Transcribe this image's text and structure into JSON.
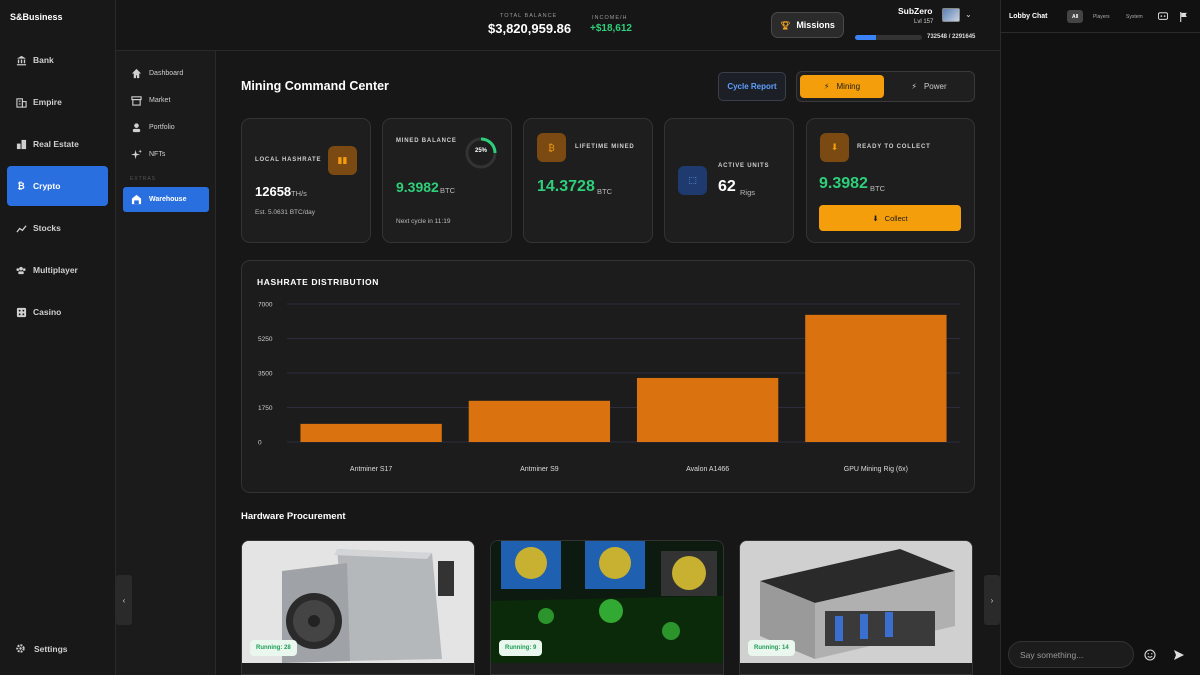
{
  "app": {
    "brand": "S&Business"
  },
  "sidebar": {
    "items": [
      {
        "label": "Bank",
        "icon": "bank-icon"
      },
      {
        "label": "Empire",
        "icon": "building-icon"
      },
      {
        "label": "Real Estate",
        "icon": "city-icon"
      },
      {
        "label": "Crypto",
        "icon": "bitcoin-icon",
        "active": true
      },
      {
        "label": "Stocks",
        "icon": "trend-icon"
      },
      {
        "label": "Multiplayer",
        "icon": "users-icon"
      },
      {
        "label": "Casino",
        "icon": "dice-icon"
      }
    ],
    "settings_label": "Settings"
  },
  "subnav": {
    "items": [
      {
        "label": "Dashboard",
        "icon": "home-icon"
      },
      {
        "label": "Market",
        "icon": "store-icon"
      },
      {
        "label": "Portfolio",
        "icon": "user-icon"
      },
      {
        "label": "NFTs",
        "icon": "sparkle-icon"
      }
    ],
    "section_label": "EXTRAS",
    "extras": [
      {
        "label": "Warehouse",
        "icon": "warehouse-icon",
        "active": true
      }
    ]
  },
  "topbar": {
    "balance_label": "TOTAL BALANCE",
    "balance_value": "$3,820,959.86",
    "income_label": "INCOME/H",
    "income_value": "+$18,612",
    "missions_label": "Missions",
    "user_name": "SubZero",
    "user_level": "Lvl 157",
    "xp_text": "732548 / 2291645",
    "xp_fraction": 0.32
  },
  "page": {
    "title": "Mining Command Center",
    "cycle_report_label": "Cycle Report",
    "toggle": {
      "mining_label": "Mining",
      "power_label": "Power"
    }
  },
  "cards": {
    "hashrate": {
      "label": "LOCAL HASHRATE",
      "value": "12658",
      "unit": "TH/s",
      "sub": "Est. 5.0631 BTC/day"
    },
    "mined": {
      "label": "MINED BALANCE",
      "value": "9.3982",
      "unit": "BTC",
      "progress": "25%",
      "sub": "Next cycle in 11:19"
    },
    "lifetime": {
      "label": "LIFETIME MINED",
      "value": "14.3728",
      "unit": "BTC"
    },
    "units": {
      "label": "ACTIVE UNITS",
      "value": "62",
      "unit": "Rigs"
    },
    "collect": {
      "label": "READY TO COLLECT",
      "value": "9.3982",
      "unit": "BTC",
      "button": "Collect"
    }
  },
  "chart_data": {
    "type": "bar",
    "title": "HASHRATE DISTRIBUTION",
    "categories": [
      "Antminer S17",
      "Antminer S9",
      "Avalon A1466",
      "GPU Mining Rig (6x)"
    ],
    "values": [
      920,
      2090,
      3250,
      6450
    ],
    "ylim": [
      0,
      7000
    ],
    "yticks": [
      "7000",
      "5250",
      "3500",
      "1750",
      "0"
    ],
    "bar_color": "#d9720f",
    "grid": true
  },
  "hardware": {
    "title": "Hardware Procurement",
    "items": [
      {
        "running": "Running: 28"
      },
      {
        "running": "Running: 9"
      },
      {
        "running": "Running: 14"
      }
    ]
  },
  "chat": {
    "title": "Lobby Chat",
    "tabs": [
      "All",
      "Players",
      "System"
    ],
    "placeholder": "Say something..."
  },
  "colors": {
    "accent": "#2a6fe0",
    "orange": "#f59e0b",
    "green": "#2ecf7a"
  }
}
